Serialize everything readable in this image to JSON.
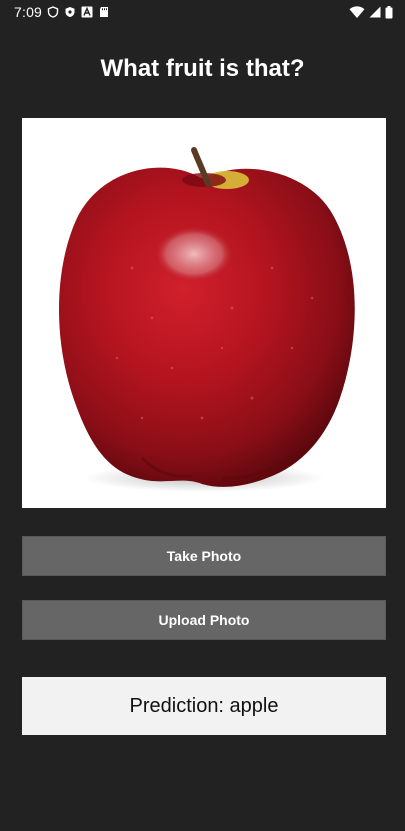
{
  "status_bar": {
    "time": "7:09",
    "left_icons": [
      "shield-outline-icon",
      "shield-filled-icon",
      "font-a-icon",
      "sd-card-icon"
    ],
    "right_icons": [
      "wifi-icon",
      "signal-icon",
      "battery-icon"
    ]
  },
  "page": {
    "title": "What fruit is that?"
  },
  "photo": {
    "subject": "apple",
    "colors": {
      "apple_red": "#b3141f",
      "apple_dark": "#6e0a10",
      "highlight": "#e8b4b8",
      "stem": "#5b3a24",
      "yellow_patch": "#d9c03a"
    }
  },
  "buttons": {
    "take_photo": "Take Photo",
    "upload_photo": "Upload Photo"
  },
  "prediction": {
    "text": "Prediction: apple"
  },
  "colors": {
    "background": "#222222",
    "button": "#666666",
    "prediction_bg": "#f2f2f2"
  }
}
